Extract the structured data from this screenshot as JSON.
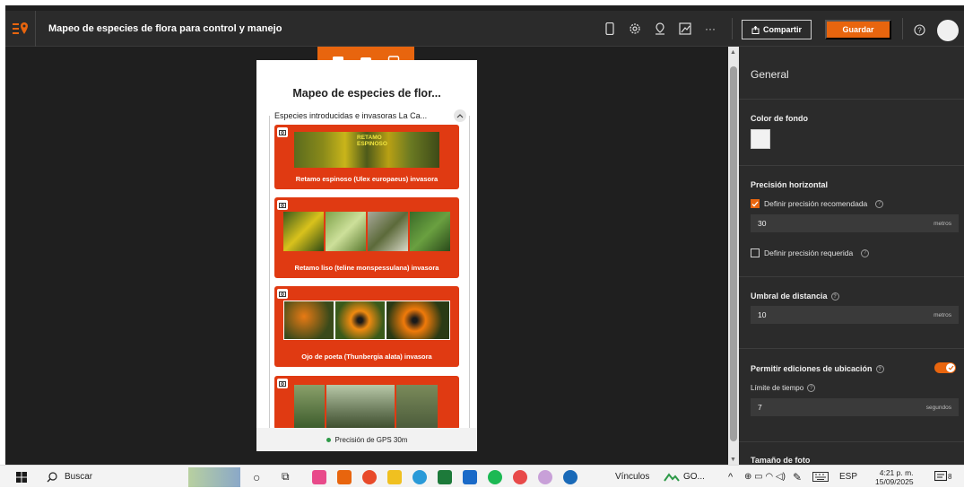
{
  "app": {
    "title": "Mapeo de especies de flora para control y manejo"
  },
  "toolbar": {
    "icons": [
      "phone-icon",
      "gear-icon",
      "pin-icon",
      "chart-icon",
      "more-icon"
    ],
    "share_label": "Compartir",
    "save_label": "Guardar"
  },
  "preview": {
    "form_title": "Mapeo de especies de flor...",
    "group_title": "Especies introducidas e invasoras La Ca...",
    "cards": [
      {
        "photo_text": "RETAMO\nESPINOSO",
        "caption": "Retamo espinoso (Ulex europaeus) invasora"
      },
      {
        "caption": "Retamo liso (teline monspessulana) invasora"
      },
      {
        "caption": "Ojo de poeta (Thunbergia alata) invasora"
      },
      {
        "caption": ""
      }
    ],
    "gps_label": "Precisión de GPS 30m"
  },
  "panel": {
    "heading": "General",
    "background_color_label": "Color de fondo",
    "background_color": "#f2f2f2",
    "horizontal_precision_label": "Precisión horizontal",
    "recommended_label": "Definir precisión recomendada",
    "recommended_checked": true,
    "recommended_value": "30",
    "recommended_unit": "metros",
    "required_label": "Definir precisión requerida",
    "required_checked": false,
    "distance_label": "Umbral de distancia",
    "distance_value": "10",
    "distance_unit": "metros",
    "location_edits_label": "Permitir ediciones de ubicación",
    "location_edits_on": true,
    "time_limit_label": "Límite de tiempo",
    "time_limit_value": "7",
    "time_limit_unit": "segundos",
    "photo_size_label": "Tamaño de foto"
  },
  "taskbar": {
    "search_label": "Buscar",
    "links_label": "Vínculos",
    "go_label": "GO...",
    "lang": "ESP",
    "time": "4:21 p. m.",
    "date": "15/09/2025",
    "notifications": "8"
  },
  "colors": {
    "accent": "#e8650e",
    "card": "#e03a12",
    "panel": "#2b2b2b"
  }
}
